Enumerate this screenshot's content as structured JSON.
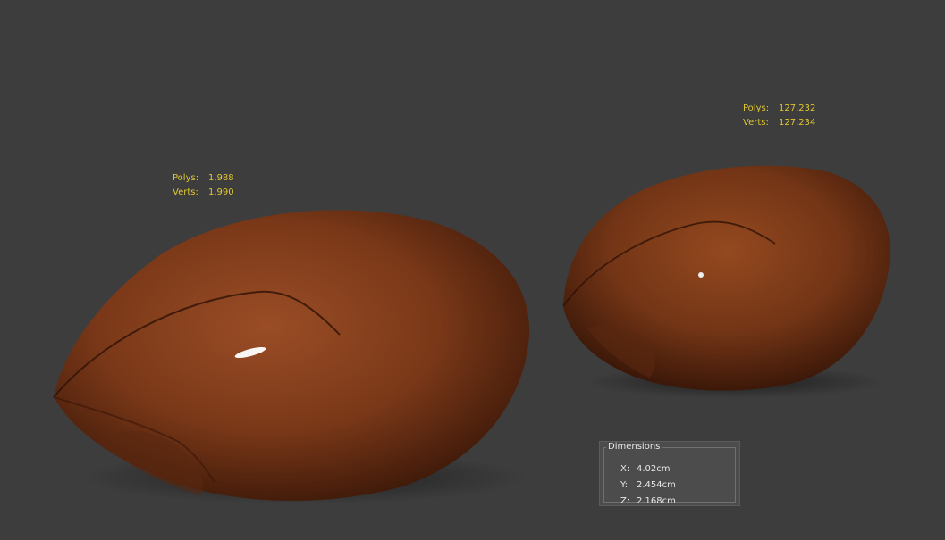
{
  "left_model": {
    "polys_label": "Polys:",
    "polys_value": "1,988",
    "verts_label": "Verts:",
    "verts_value": "1,990"
  },
  "right_model": {
    "polys_label": "Polys:",
    "polys_value": "127,232",
    "verts_label": "Verts:",
    "verts_value": "127,234"
  },
  "dimensions": {
    "title": "Dimensions",
    "x_label": "X:",
    "x_value": "4.02cm",
    "y_label": "Y:",
    "y_value": "2.454cm",
    "z_label": "Z:",
    "z_value": "2.168cm"
  },
  "colors": {
    "background": "#3d3d3d",
    "stats_text": "#e2c631",
    "shell_base": "#7a3a1a"
  }
}
